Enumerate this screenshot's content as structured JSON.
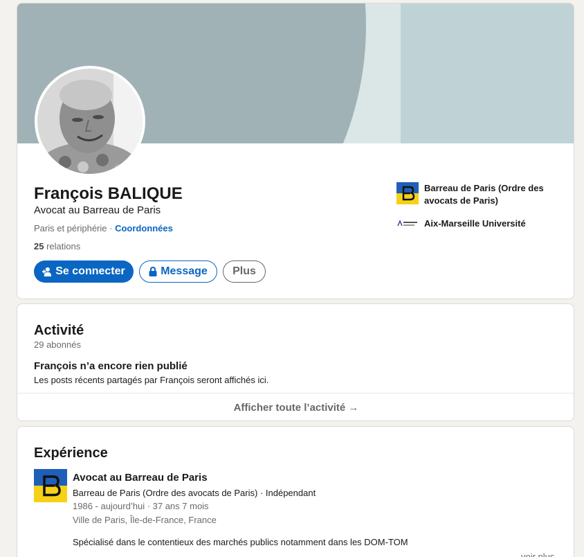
{
  "profile": {
    "name": "François BALIQUE",
    "headline": "Avocat au Barreau de Paris",
    "location": "Paris et périphérie",
    "separator": " · ",
    "contact_link": "Coordonnées",
    "relations_count": "25",
    "relations_label": " relations",
    "buttons": {
      "connect": "Se connecter",
      "message": "Message",
      "more": "Plus"
    },
    "organizations": [
      {
        "name": "Barreau de Paris (Ordre des avocats de Paris)",
        "logo": "barreau-logo"
      },
      {
        "name": "Aix-Marseille Université",
        "logo": "amu-logo"
      }
    ]
  },
  "activity": {
    "title": "Activité",
    "followers": "29 abonnés",
    "empty_title": "François n’a encore rien publié",
    "empty_text": "Les posts récents partagés par François seront affichés ici.",
    "show_all": "Afficher toute l’activité →"
  },
  "experience": {
    "title": "Expérience",
    "items": [
      {
        "role": "Avocat au Barreau de Paris",
        "company": "Barreau de Paris (Ordre des avocats de Paris) · Indépendant",
        "dates": "1986 - aujourd’hui · 37 ans 7 mois",
        "location": "Ville de Paris, Île-de-France, France",
        "description": "Spécialisé dans le contentieux des marchés publics notamment dans les DOM-TOM",
        "see_more": "voir plus"
      }
    ]
  },
  "colors": {
    "accent": "#0a66c2",
    "banner_light": "#bfd3d6",
    "banner_dark": "#a0b2b6",
    "barreau_blue": "#1f5fb8",
    "barreau_yellow": "#f7d117"
  }
}
